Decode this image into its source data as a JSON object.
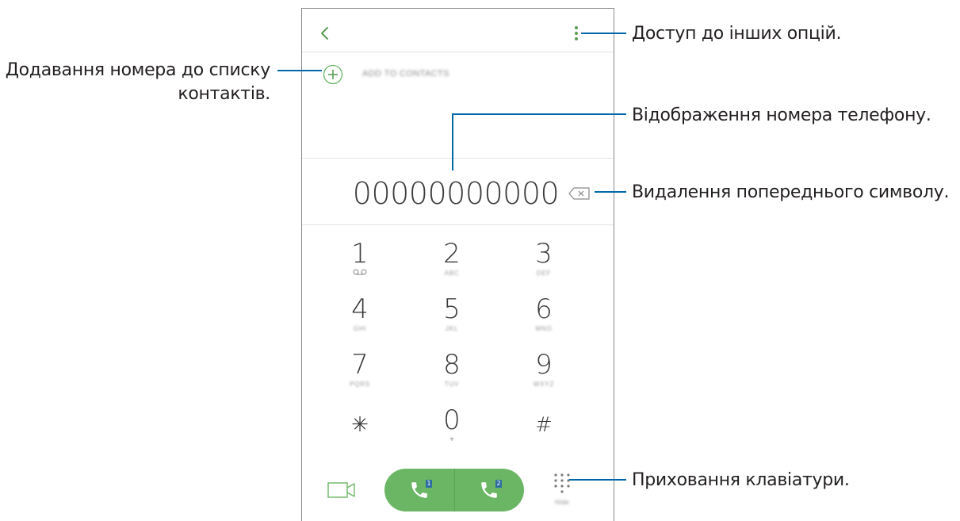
{
  "annotations": {
    "more_options": "Доступ до інших опцій.",
    "add_to_contacts_line1": "Додавання номера до списку",
    "add_to_contacts_line2": "контактів.",
    "phone_number_display": "Відображення номера телефону.",
    "delete_previous": "Видалення попереднього символу.",
    "hide_keypad": "Приховання клавіатури."
  },
  "screen": {
    "add_to_contacts_label": "ADD TO CONTACTS",
    "entered_number": "00000000000",
    "keys": [
      {
        "digit": "1",
        "letters": "",
        "icon": "voicemail-icon"
      },
      {
        "digit": "2",
        "letters": "ABC"
      },
      {
        "digit": "3",
        "letters": "DEF"
      },
      {
        "digit": "4",
        "letters": "GHI"
      },
      {
        "digit": "5",
        "letters": "JKL"
      },
      {
        "digit": "6",
        "letters": "MNO"
      },
      {
        "digit": "7",
        "letters": "PQRS"
      },
      {
        "digit": "8",
        "letters": "TUV"
      },
      {
        "digit": "9",
        "letters": "WXYZ"
      },
      {
        "digit": "✳",
        "letters": ""
      },
      {
        "digit": "0",
        "letters": "+"
      },
      {
        "digit": "#",
        "letters": ""
      }
    ],
    "sim1_label": "1",
    "sim2_label": "2",
    "hide_label": "Hide"
  },
  "colors": {
    "accent_green": "#6bb665",
    "callout_blue": "#0068a8",
    "sim_badge_blue": "#2e6da3"
  },
  "icons": {
    "back": "chevron-left-icon",
    "more": "more-vertical-icon",
    "add": "plus-circle-icon",
    "backspace": "backspace-icon",
    "video": "video-call-icon",
    "call": "phone-icon",
    "keypad": "keypad-grid-icon"
  }
}
